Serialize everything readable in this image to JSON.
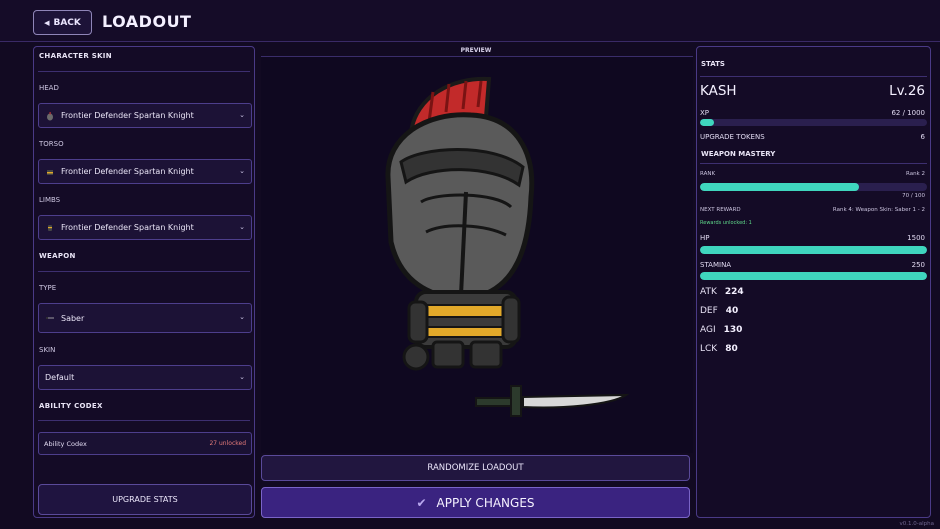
{
  "header": {
    "back_label": "BACK",
    "title": "LOADOUT"
  },
  "left": {
    "character_skin_heading": "CHARACTER SKIN",
    "head_label": "HEAD",
    "head_value": "Frontier Defender Spartan Knight",
    "torso_label": "TORSO",
    "torso_value": "Frontier Defender Spartan Knight",
    "limbs_label": "LIMBS",
    "limbs_value": "Frontier Defender Spartan Knight",
    "weapon_heading": "WEAPON",
    "type_label": "TYPE",
    "type_value": "Saber",
    "skin_label": "SKIN",
    "skin_value": "Default",
    "codex_heading": "ABILITY CODEX",
    "codex_label": "Ability Codex",
    "codex_count": "27 unlocked",
    "upgrade_label": "UPGRADE STATS"
  },
  "center": {
    "preview_label": "PREVIEW",
    "randomize_label": "RANDOMIZE LOADOUT",
    "apply_label": "APPLY CHANGES"
  },
  "stats": {
    "heading": "STATS",
    "name": "KASH",
    "level": "Lv.26",
    "xp_label": "XP",
    "xp_value": "62 / 1000",
    "xp_fraction": 0.062,
    "tokens_label": "UPGRADE TOKENS",
    "tokens_value": "6",
    "mastery_heading": "WEAPON MASTERY",
    "rank_label": "RANK",
    "rank_value": "Rank 2",
    "rank_fraction": 0.7,
    "rank_progress": "70 / 100",
    "next_reward_label": "NEXT REWARD",
    "next_reward_value": "Rank 4: Weapon Skin: Saber 1 - 2",
    "rewards_unlocked": "Rewards unlocked: 1",
    "hp_label": "HP",
    "hp_value": "1500",
    "hp_fraction": 1.0,
    "stamina_label": "STAMINA",
    "stamina_value": "250",
    "stamina_fraction": 1.0,
    "attributes": [
      {
        "label": "ATK",
        "value": "224"
      },
      {
        "label": "DEF",
        "value": "40"
      },
      {
        "label": "AGI",
        "value": "130"
      },
      {
        "label": "LCK",
        "value": "80"
      }
    ]
  },
  "footer": {
    "version": "v0.1.0-alpha"
  },
  "colors": {
    "accent": "#3fd6be",
    "panel_border": "#4a3a86",
    "background": "#120a22",
    "apply": "#3a2380"
  },
  "icons": {
    "back": "triangle-left-icon",
    "chevron": "chevron-down-icon",
    "check": "check-icon"
  }
}
